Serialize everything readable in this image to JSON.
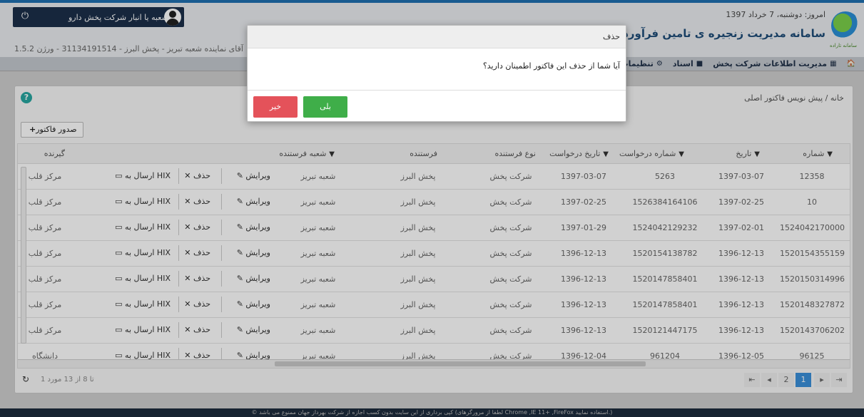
{
  "header": {
    "date_text": "امروز: دوشنبه، 7 خرداد 1397",
    "system_title": "سامانه مدیریت زنجیره ی تامین فرآورده های س",
    "logo_subtext": "سامانه تاراده",
    "user_box_name": "شعبه یا انبار شرکت پخش دارو",
    "user_info": "آقای نماینده شعبه تبریز - پخش البرز - 31134191514 - ورژن 1.5.2"
  },
  "menu": {
    "items": [
      {
        "label": "",
        "icon": "home-icon"
      },
      {
        "label": "مدیریت اطلاعات شرکت پخش",
        "icon": "building-icon"
      },
      {
        "label": "اسناد",
        "icon": "folder-icon"
      },
      {
        "label": "تنظیمات",
        "icon": "gears-icon"
      }
    ]
  },
  "breadcrumb": {
    "home": "خانه",
    "sep": "/",
    "current": "پیش نویس فاکتور اصلی"
  },
  "toolbar": {
    "issue_invoice_label": "صدور فاکتور"
  },
  "table": {
    "columns": [
      "شماره",
      "تاریخ",
      "شماره درخواست",
      "تاریخ درخواست",
      "نوع فرستنده",
      "فرستنده",
      "شعبه فرستنده",
      "گیرنده"
    ],
    "actions": {
      "edit": "ویرایش",
      "delete": "حذف",
      "send_hix": "ارسال به HIX"
    },
    "rows": [
      {
        "number": "12358",
        "date": "1397-03-07",
        "req_number": "5263",
        "req_date": "1397-03-07",
        "sender_type": "شرکت پخش",
        "sender": "پخش البرز",
        "sender_branch": "شعبه تبریز",
        "receiver": "مرکز قلب"
      },
      {
        "number": "10",
        "date": "1397-02-25",
        "req_number": "1526384164106",
        "req_date": "1397-02-25",
        "sender_type": "شرکت پخش",
        "sender": "پخش البرز",
        "sender_branch": "شعبه تبریز",
        "receiver": "مرکز قلب"
      },
      {
        "number": "1524042170000",
        "date": "1397-02-01",
        "req_number": "1524042129232",
        "req_date": "1397-01-29",
        "sender_type": "شرکت پخش",
        "sender": "پخش البرز",
        "sender_branch": "شعبه تبریز",
        "receiver": "مرکز قلب"
      },
      {
        "number": "1520154355159",
        "date": "1396-12-13",
        "req_number": "1520154138782",
        "req_date": "1396-12-13",
        "sender_type": "شرکت پخش",
        "sender": "پخش البرز",
        "sender_branch": "شعبه تبریز",
        "receiver": "مرکز قلب"
      },
      {
        "number": "1520150314996",
        "date": "1396-12-13",
        "req_number": "1520147858401",
        "req_date": "1396-12-13",
        "sender_type": "شرکت پخش",
        "sender": "پخش البرز",
        "sender_branch": "شعبه تبریز",
        "receiver": "مرکز قلب"
      },
      {
        "number": "1520148327872",
        "date": "1396-12-13",
        "req_number": "1520147858401",
        "req_date": "1396-12-13",
        "sender_type": "شرکت پخش",
        "sender": "پخش البرز",
        "sender_branch": "شعبه تبریز",
        "receiver": "مرکز قلب"
      },
      {
        "number": "1520143706202",
        "date": "1396-12-13",
        "req_number": "1520121447175",
        "req_date": "1396-12-13",
        "sender_type": "شرکت پخش",
        "sender": "پخش البرز",
        "sender_branch": "شعبه تبریز",
        "receiver": "مرکز قلب"
      },
      {
        "number": "96125",
        "date": "1396-12-05",
        "req_number": "961204",
        "req_date": "1396-12-04",
        "sender_type": "شرکت پخش",
        "sender": "پخش البرز",
        "sender_branch": "شعبه تبریز",
        "receiver": "دانشگاه"
      }
    ]
  },
  "pager": {
    "pages": [
      "1",
      "2"
    ],
    "current": "1",
    "range_text": "1 تا 8 از 13 مورد"
  },
  "footer": {
    "text": "© کپی برداری از این سایت بدون کسب اجازه از شرکت بهرداز جهان ممنوع می باشد (لطفا از مرورگرهای Chrome ,IE 11+ ,FireFox استفاده نمایید.)"
  },
  "modal": {
    "title": "حذف",
    "message": "آیا شما از حذف این فاکتور اطمینان دارید؟",
    "yes_label": "بلی",
    "no_label": "خیر"
  }
}
